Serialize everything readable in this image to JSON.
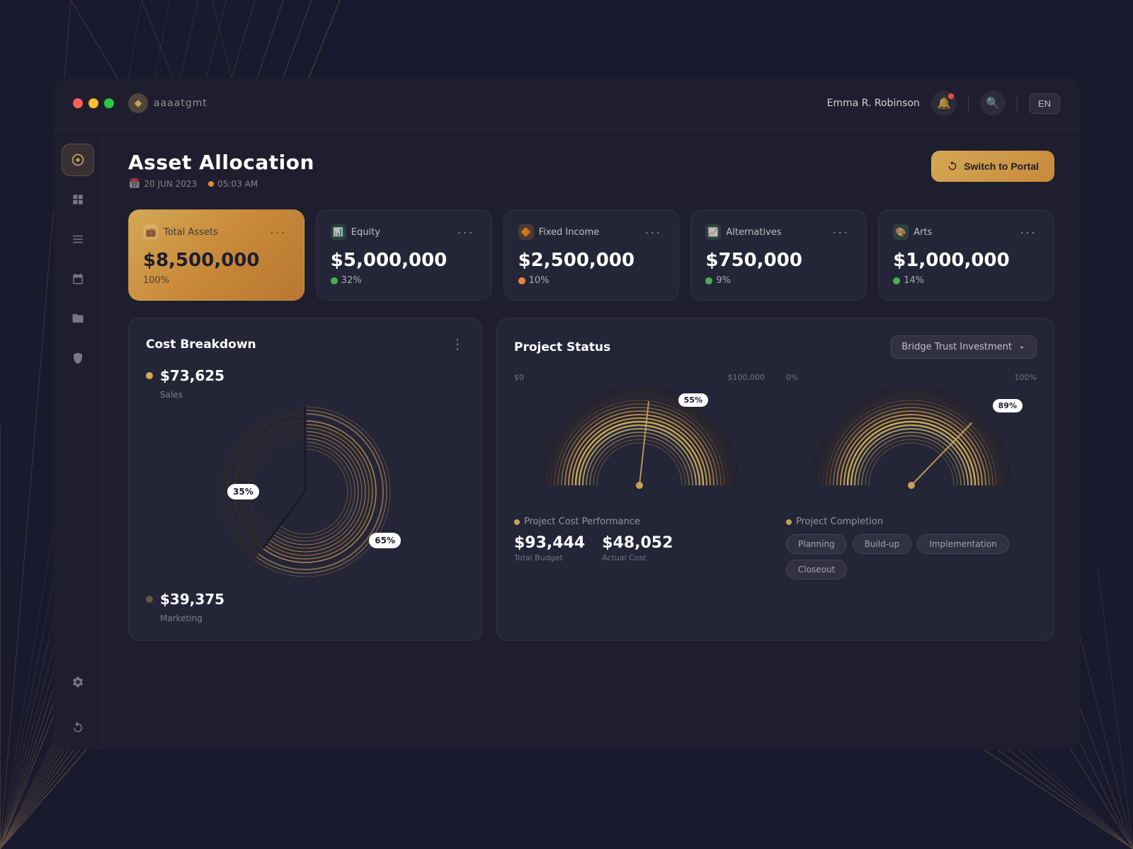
{
  "app": {
    "brand": "◆",
    "brand_name": "aaaatgmt"
  },
  "titlebar": {
    "user_name": "Emma R. Robinson",
    "lang": "EN"
  },
  "sidebar": {
    "items": [
      {
        "icon": "⏱",
        "label": "dashboard",
        "active": true
      },
      {
        "icon": "⊞",
        "label": "grid"
      },
      {
        "icon": "≡",
        "label": "list"
      },
      {
        "icon": "📅",
        "label": "calendar"
      },
      {
        "icon": "🗂",
        "label": "folders"
      },
      {
        "icon": "🛡",
        "label": "security"
      },
      {
        "icon": "⚙",
        "label": "settings"
      },
      {
        "icon": "↩",
        "label": "back"
      }
    ]
  },
  "page": {
    "title": "Asset Allocation",
    "date": "20 JUN 2023",
    "time": "05:03 AM",
    "switch_button": "Switch to Portal"
  },
  "asset_cards": [
    {
      "label": "Total Assets",
      "amount": "$8,500,000",
      "pct": "100%",
      "pct_type": "none",
      "featured": true
    },
    {
      "label": "Equity",
      "amount": "$5,000,000",
      "pct": "32%",
      "pct_type": "green"
    },
    {
      "label": "Fixed Income",
      "amount": "$2,500,000",
      "pct": "10%",
      "pct_type": "orange"
    },
    {
      "label": "Alternatives",
      "amount": "$750,000",
      "pct": "9%",
      "pct_type": "green"
    },
    {
      "label": "Arts",
      "amount": "$1,000,000",
      "pct": "14%",
      "pct_type": "green"
    }
  ],
  "cost_breakdown": {
    "title": "Cost Breakdown",
    "items": [
      {
        "amount": "$73,625",
        "label": "Sales",
        "pct": "65%"
      },
      {
        "amount": "$39,375",
        "label": "Marketing",
        "pct": "35%"
      }
    ],
    "donut_label_35": "35%",
    "donut_label_65": "65%"
  },
  "project_status": {
    "title": "Project Status",
    "dropdown": "Bridge Trust Investment",
    "cost_gauge": {
      "scale_start": "$0",
      "scale_end": "$100,000",
      "value_pct": 55,
      "label": "55%",
      "title": "Project Cost Performance",
      "budget_total": "$93,444",
      "budget_total_label": "Total Budget",
      "budget_actual": "$48,052",
      "budget_actual_label": "Actual Cost"
    },
    "completion_gauge": {
      "scale_start": "0%",
      "scale_end": "100%",
      "value_pct": 89,
      "label": "89%",
      "title": "Project Completion",
      "tags": [
        "Planning",
        "Build-up",
        "Implementation",
        "Closeout"
      ]
    }
  }
}
